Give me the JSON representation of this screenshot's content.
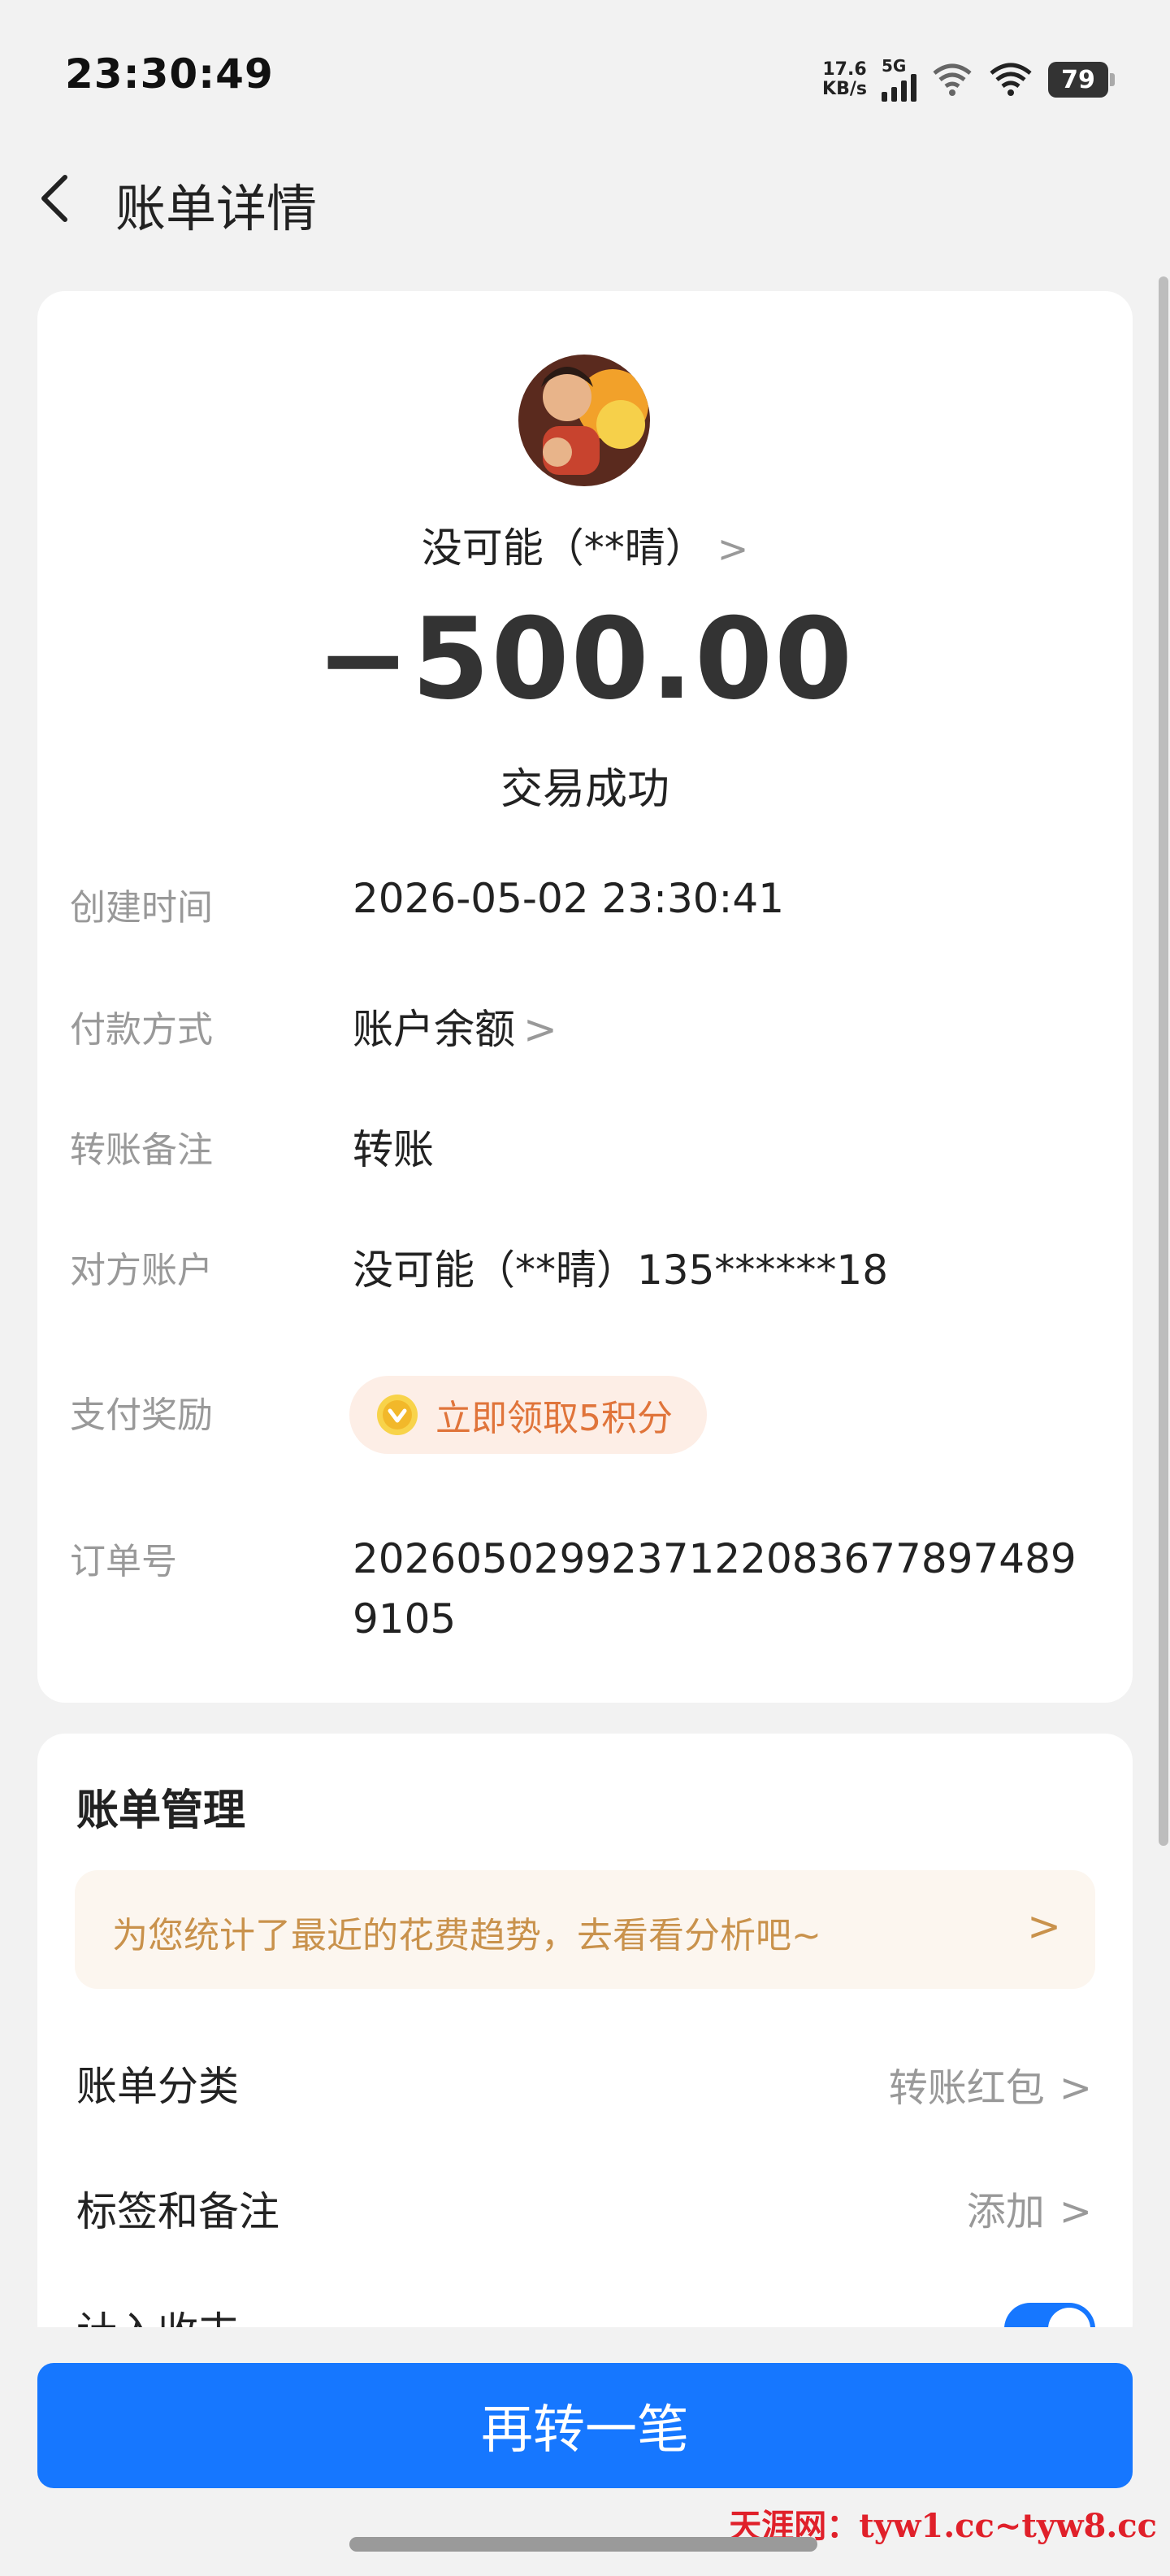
{
  "status_bar": {
    "time": "23:30:49",
    "net_speed_value": "17.6",
    "net_speed_unit": "KB/s",
    "signal_tag": "5G",
    "battery": "79"
  },
  "header": {
    "title": "账单详情",
    "back_icon": "chevron-left-icon"
  },
  "bill": {
    "payee": "没可能（**晴）",
    "payee_chevron": ">",
    "amount": "−500.00",
    "status": "交易成功",
    "rows": [
      {
        "label": "创建时间",
        "value": "2026-05-02 23:30:41"
      },
      {
        "label": "付款方式",
        "value": "账户余额",
        "chevron": ">"
      },
      {
        "label": "转账备注",
        "value": "转账"
      },
      {
        "label": "对方账户",
        "value": "没可能（**晴）135******18"
      },
      {
        "label": "支付奖励",
        "value": "立即领取5积分"
      },
      {
        "label": "订单号",
        "value": "20260502992371220836778974899105"
      }
    ]
  },
  "manage": {
    "title": "账单管理",
    "trend_text": "为您统计了最近的花费趋势，去看看分析吧~",
    "trend_chevron": ">",
    "category_label": "账单分类",
    "category_value": "转账红包",
    "tags_label": "标签和备注",
    "tags_value": "添加",
    "row_chevron": ">",
    "income_label": "计入收支",
    "income_enabled": true
  },
  "cta": {
    "label": "再转一笔"
  },
  "watermark": "天涯网：tyw1.cc~tyw8.cc",
  "colors": {
    "accent": "#1677ff",
    "reward_text": "#e0743a",
    "reward_bg": "#fdeee6",
    "trend_text": "#c9924c",
    "trend_bg": "#fcf6ef",
    "watermark": "#e0202a"
  }
}
